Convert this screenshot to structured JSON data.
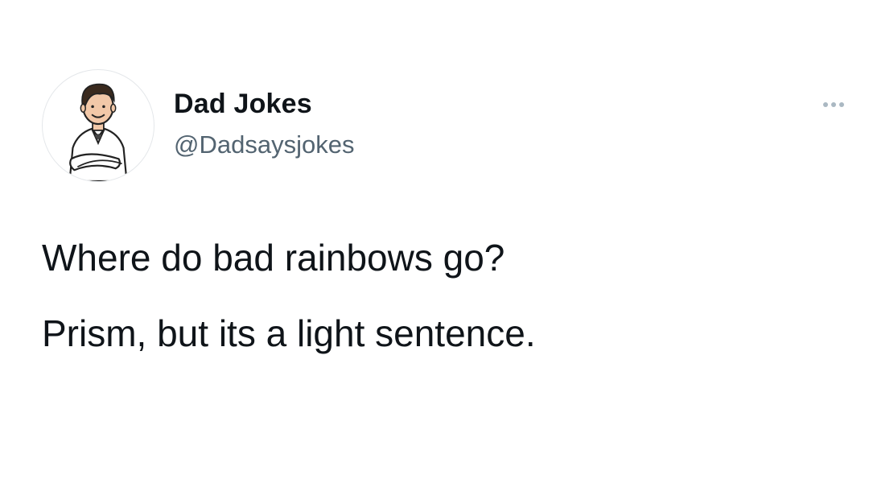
{
  "author": {
    "display_name": "Dad Jokes",
    "handle": "@Dadsaysjokes",
    "avatar_icon": "cartoon-man-arms-crossed"
  },
  "menu": {
    "more_icon": "ellipsis-icon"
  },
  "tweet": {
    "lines": [
      "Where do bad rainbows go?",
      "Prism, but its a light sentence."
    ]
  },
  "colors": {
    "text": "#0f1419",
    "secondary_text": "#536471",
    "more_dots": "#aab8c2",
    "background": "#ffffff"
  }
}
